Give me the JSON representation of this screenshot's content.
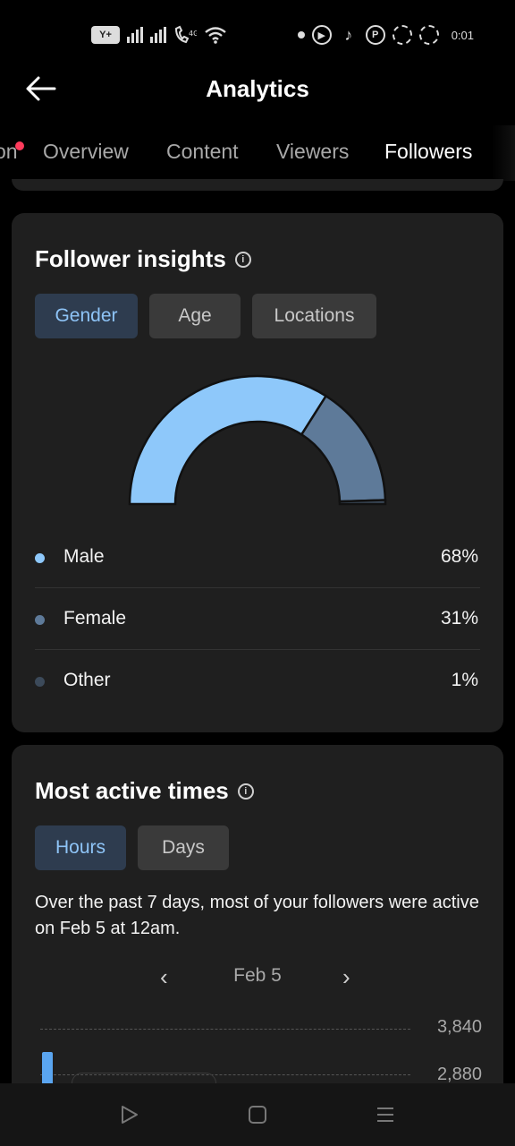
{
  "status_bar": {
    "sim_label": "Y+",
    "time": "0:01"
  },
  "header": {
    "title": "Analytics"
  },
  "tabs": [
    {
      "label": "on",
      "active": false,
      "has_notification": true
    },
    {
      "label": "Overview",
      "active": false
    },
    {
      "label": "Content",
      "active": false
    },
    {
      "label": "Viewers",
      "active": false
    },
    {
      "label": "Followers",
      "active": true
    }
  ],
  "follower_insights": {
    "title": "Follower insights",
    "filters": [
      {
        "label": "Gender",
        "active": true
      },
      {
        "label": "Age",
        "active": false
      },
      {
        "label": "Locations",
        "active": false
      }
    ],
    "gender": [
      {
        "label": "Male",
        "value": "68%",
        "percent": 68,
        "color": "#8ec8fa"
      },
      {
        "label": "Female",
        "value": "31%",
        "percent": 31,
        "color": "#5e7a99"
      },
      {
        "label": "Other",
        "value": "1%",
        "percent": 1,
        "color": "#3c4a5a"
      }
    ]
  },
  "most_active_times": {
    "title": "Most active times",
    "filters": [
      {
        "label": "Hours",
        "active": true
      },
      {
        "label": "Days",
        "active": false
      }
    ],
    "summary": "Over the past 7 days, most of your followers were active on Feb 5 at 12am.",
    "date": "Feb 5",
    "y_ticks": [
      "3,840",
      "2,880"
    ]
  },
  "colors": {
    "accent": "#8ec4f7",
    "card": "#1f1f1f",
    "notification": "#ff3b5c"
  }
}
